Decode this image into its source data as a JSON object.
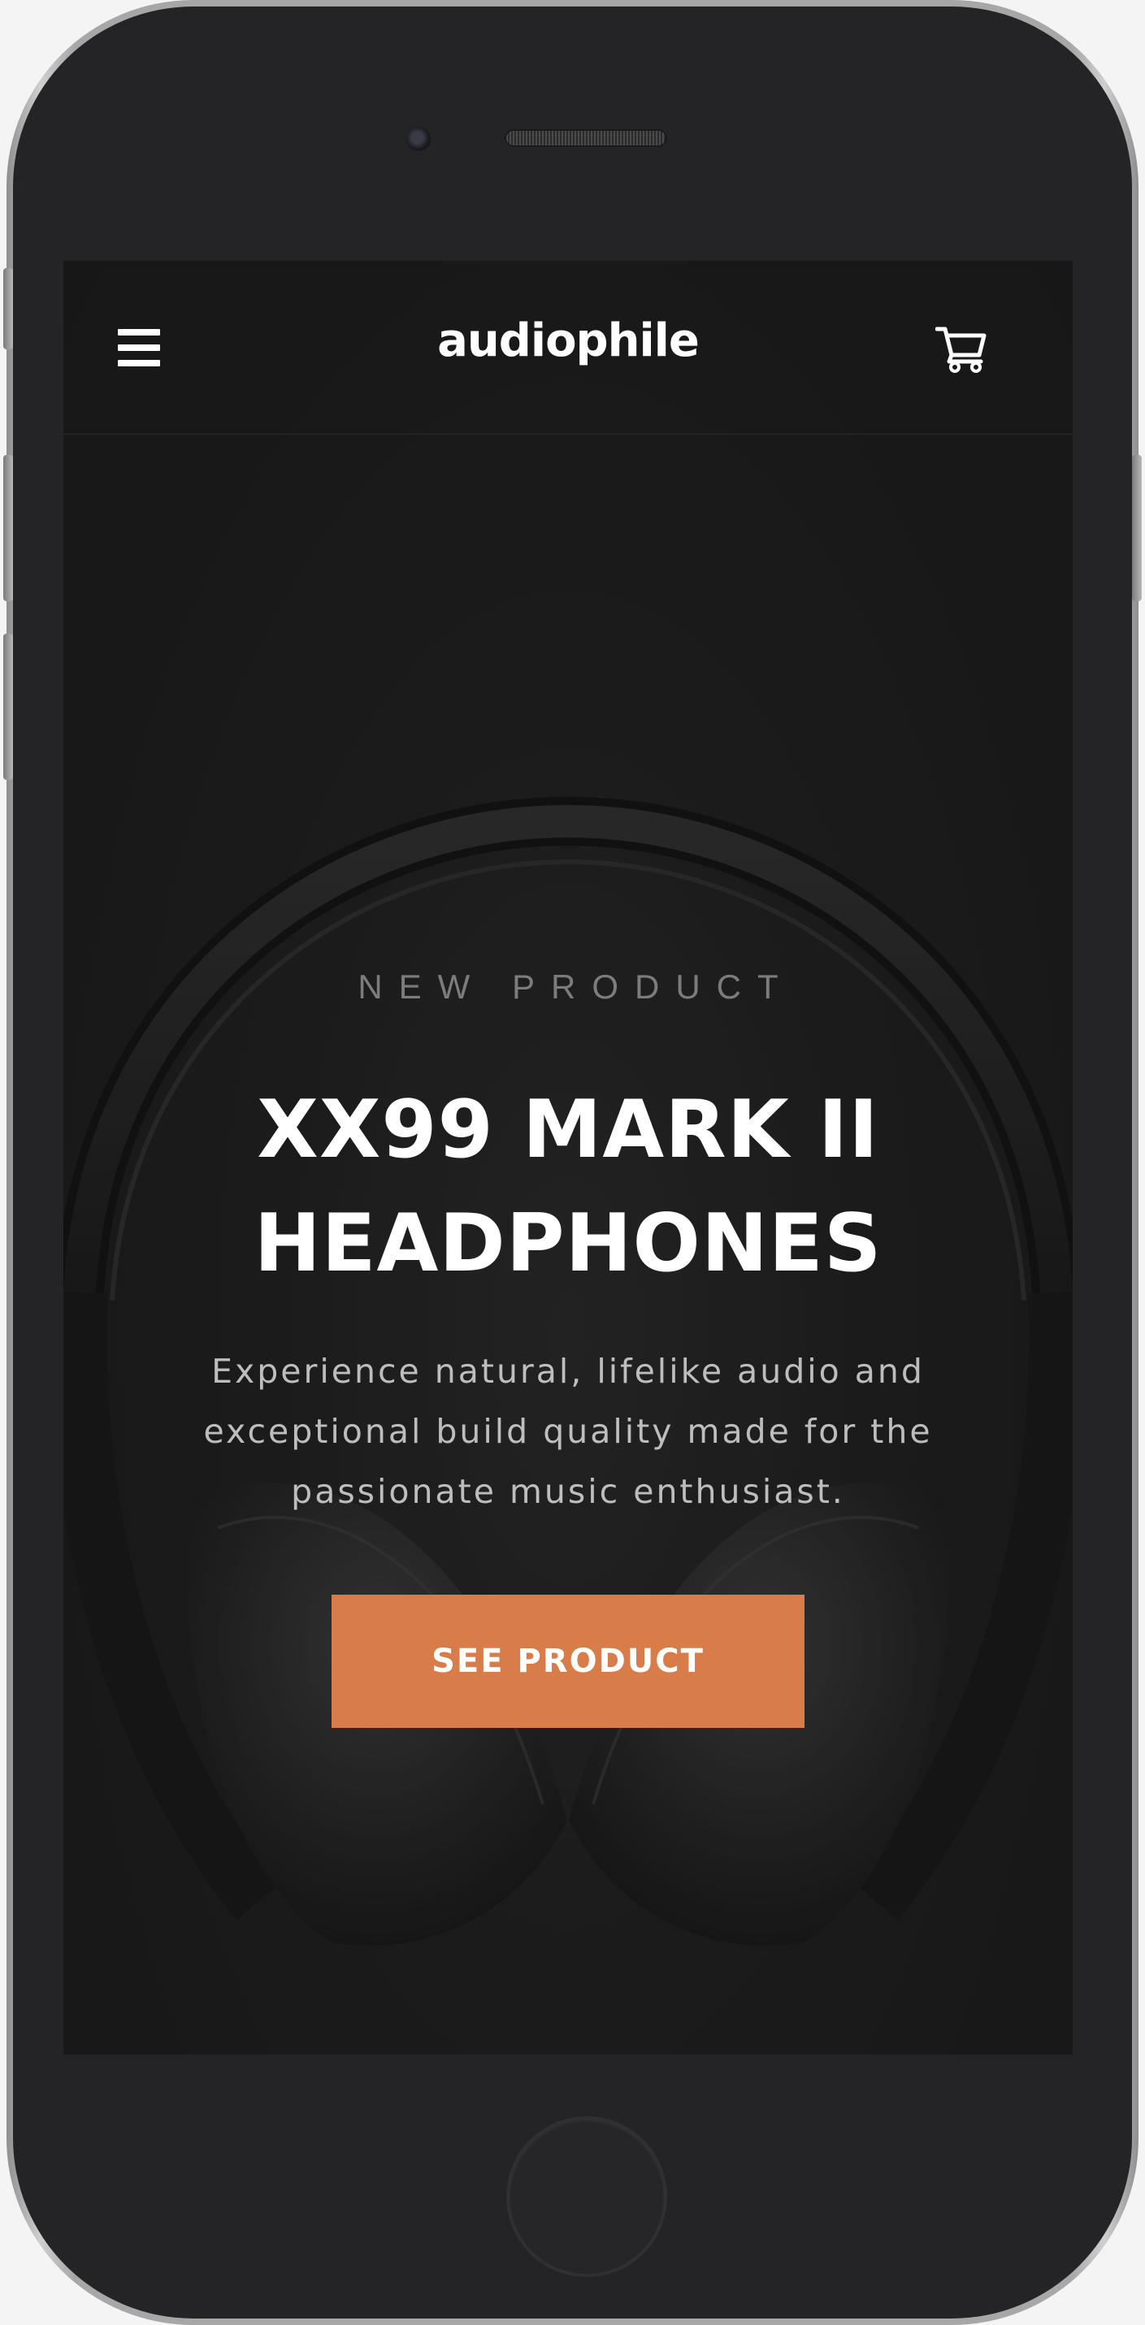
{
  "header": {
    "logo": "audiophile",
    "menu_icon": "hamburger-menu-icon",
    "cart_icon": "shopping-cart-icon"
  },
  "hero": {
    "overline": "NEW PRODUCT",
    "title_line1": "XX99 MARK II",
    "title_line2": "HEADPHONES",
    "description": "Experience natural, lifelike audio and exceptional build quality made for the passionate music enthusiast.",
    "cta_label": "SEE PRODUCT"
  },
  "colors": {
    "accent": "#D87D4A",
    "background": "#191919",
    "text": "#FFFFFF"
  }
}
